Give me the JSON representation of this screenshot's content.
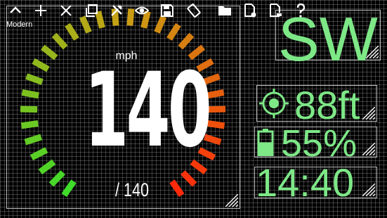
{
  "toolbar": {
    "icons": [
      "chevron-up-icon",
      "plus-icon",
      "close-icon",
      "copy-icon",
      "tools-icon",
      "eye-icon",
      "save-icon",
      "rotate-screen-icon",
      "folder-icon",
      "export-icon",
      "import-icon",
      "help-icon"
    ]
  },
  "speedometer": {
    "mode": "Modern",
    "unit": "mph",
    "speed": "140",
    "max": "/ 140"
  },
  "compass": {
    "heading": "SW"
  },
  "gps": {
    "accuracy": "88ft"
  },
  "battery": {
    "level": "55%",
    "fill_fraction": 0.55
  },
  "clock": {
    "time": "14:40"
  },
  "colors": {
    "value_green": "#7ee887",
    "gauge_start": "#3fdc2a",
    "gauge_end": "#ff2a0a"
  }
}
